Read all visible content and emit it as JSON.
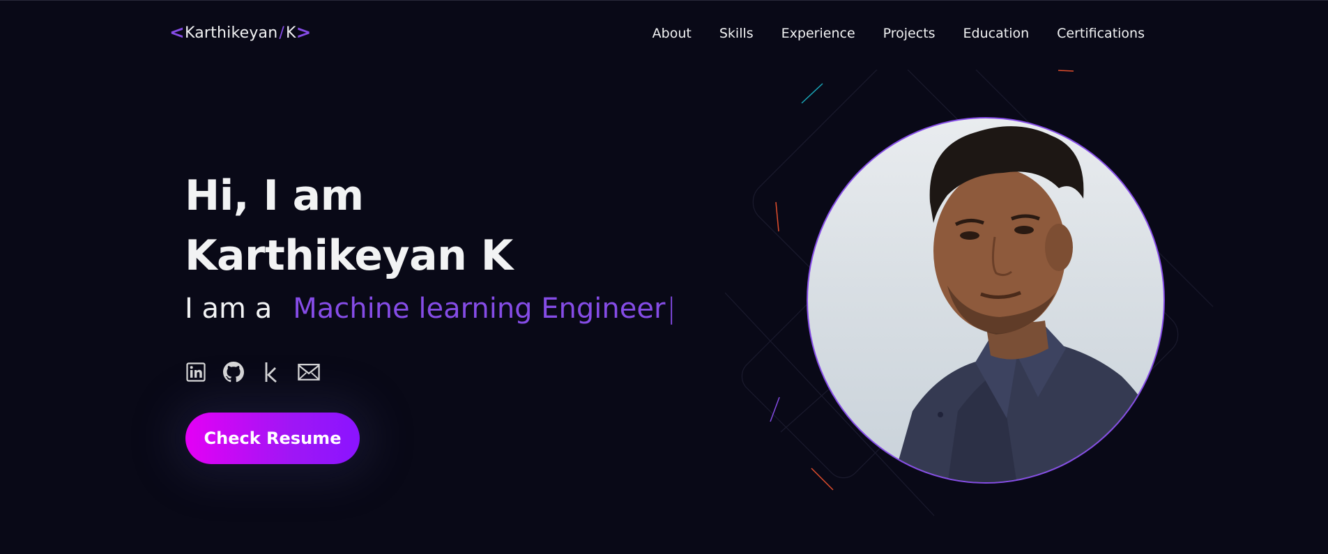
{
  "brand": {
    "open_bracket": "<",
    "name": "Karthikeyan",
    "slash": "/",
    "initial": "K",
    "close_bracket": ">"
  },
  "nav": {
    "items": [
      "About",
      "Skills",
      "Experience",
      "Projects",
      "Education",
      "Certifications"
    ]
  },
  "hero": {
    "greeting": "Hi, I am",
    "name": "Karthikeyan K",
    "role_prefix": "I am a",
    "role": "Machine learning Engineer",
    "cursor": "|",
    "resume_button": "Check Resume"
  },
  "socials": [
    "linkedin-icon",
    "github-icon",
    "kaggle-icon",
    "mail-icon"
  ],
  "colors": {
    "background": "#090917",
    "accent": "#854ce6",
    "text": "#f2f3f4",
    "button_gradient_start": "#e400f5",
    "button_gradient_end": "#8a14ff"
  }
}
